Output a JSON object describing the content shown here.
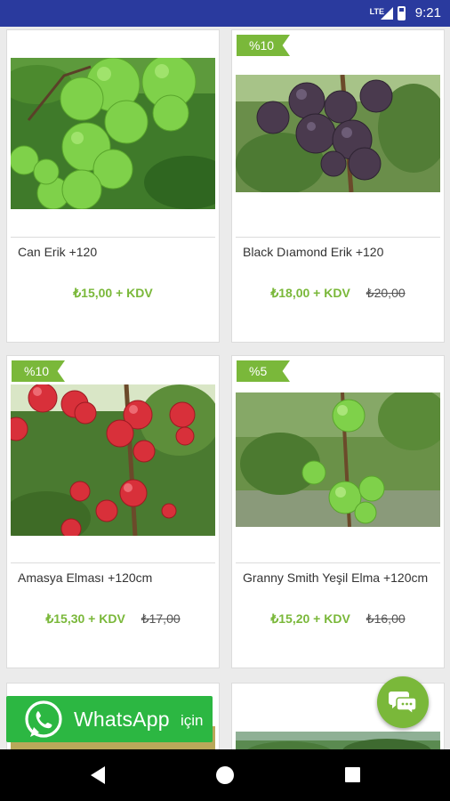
{
  "status_bar": {
    "network": "LTE",
    "time": "9:21"
  },
  "products": [
    {
      "name": "Can Erik +120",
      "price": "₺15,00 + KDV",
      "old_price": "",
      "discount": "",
      "image": "green-plums-photo"
    },
    {
      "name": "Black Dıamond Erik +120",
      "price": "₺18,00 + KDV",
      "old_price": "₺20,00",
      "discount": "%10",
      "image": "dark-plums-photo"
    },
    {
      "name": "Amasya Elması +120cm",
      "price": "₺15,30 + KDV",
      "old_price": "₺17,00",
      "discount": "%10",
      "image": "red-apples-photo"
    },
    {
      "name": "Granny Smith Yeşil Elma +120cm",
      "price": "₺15,20 + KDV",
      "old_price": "₺16,00",
      "discount": "%5",
      "image": "green-apples-photo"
    }
  ],
  "whatsapp": {
    "label": "WhatsApp",
    "suffix": "için",
    "color": "#2cb742"
  },
  "colors": {
    "accent": "#7ab83a",
    "status_bar": "#2a3a9e"
  },
  "icons": {
    "chat": "chat-bubbles-icon",
    "whatsapp": "whatsapp-icon"
  }
}
